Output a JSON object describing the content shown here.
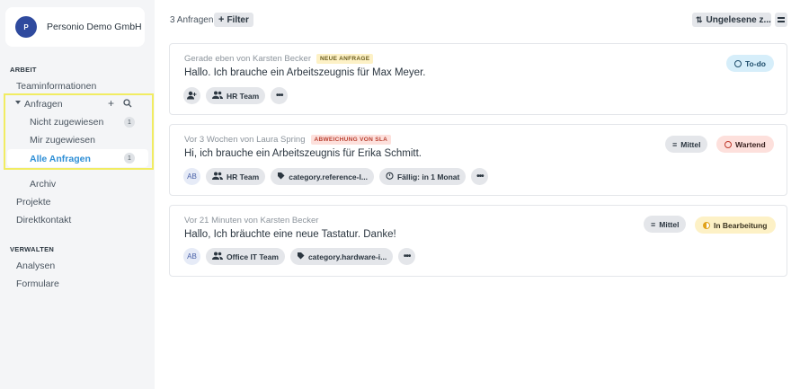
{
  "sidebar": {
    "company_logo": "P",
    "company_name": "Personio Demo GmbH",
    "section_work": "ARBEIT",
    "team_info": "Teaminformationen",
    "requests": "Anfragen",
    "unassigned": "Nicht zugewiesen",
    "unassigned_count": "1",
    "assigned_to_me": "Mir zugewiesen",
    "all_requests": "Alle Anfragen",
    "all_requests_count": "1",
    "archive": "Archiv",
    "projects": "Projekte",
    "direct_contact": "Direktkontakt",
    "section_manage": "VERWALTEN",
    "analytics": "Analysen",
    "forms": "Formulare",
    "accent_color": "#2f8fd6"
  },
  "toolbar": {
    "count_label": "3 Anfragen",
    "filter_label": "Filter",
    "sort_label": "Ungelesene z..."
  },
  "requests": [
    {
      "meta": "Gerade eben von Karsten Becker",
      "tag": "NEUE ANFRAGE",
      "title": "Hallo. Ich brauche ein Arbeitszeugnis für Max Meyer.",
      "team": "HR Team",
      "status": "To-do"
    },
    {
      "meta": "Vor 3 Wochen von Laura Spring",
      "tag": "ABWEICHUNG VON SLA",
      "title": "Hi, ich brauche ein Arbeitszeugnis für Erika Schmitt.",
      "avatar": "AB",
      "team": "HR Team",
      "category": "category.reference-l...",
      "due": "Fällig: in 1 Monat",
      "priority": "Mittel",
      "status": "Wartend"
    },
    {
      "meta": "Vor 21 Minuten von Karsten Becker",
      "title": "Hallo, Ich bräuchte eine neue Tastatur. Danke!",
      "avatar": "AB",
      "team": "Office IT Team",
      "category": "category.hardware-i...",
      "priority": "Mittel",
      "status": "In Bearbeitung"
    }
  ]
}
